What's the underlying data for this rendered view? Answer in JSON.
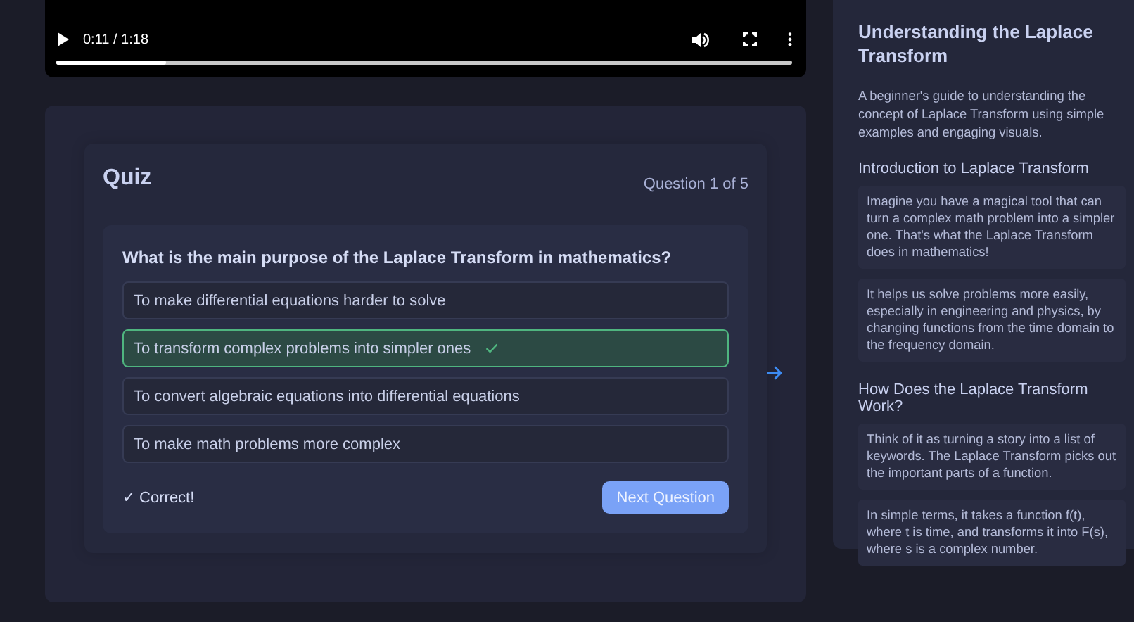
{
  "video": {
    "playing": false,
    "time": "0:11 / 1:18",
    "level": 0.15
  },
  "quiz": {
    "title": "Quiz",
    "progress": "Question 1 of 5",
    "question": "What is the main purpose of the Laplace Transform in mathematics?",
    "options": [
      {
        "label": "To make differential equations harder to solve",
        "selected": false
      },
      {
        "label": "To transform complex problems into simpler ones",
        "selected": true
      },
      {
        "label": "To convert algebraic equations into differential equations",
        "selected": false
      },
      {
        "label": "To make math problems more complex",
        "selected": false
      }
    ],
    "feedback": "✓ Correct!",
    "next_button": "Next Question"
  },
  "sidebar": {
    "title": "Understanding the Laplace Transform",
    "description": "A beginner's guide to understanding the concept of Laplace Transform using simple examples and engaging visuals.",
    "sections": [
      {
        "heading": "Introduction to Laplace Transform",
        "paragraphs": [
          "Imagine you have a magical tool that can turn a complex math problem into a simpler one. That's what the Laplace Transform does in mathematics!",
          "It helps us solve problems more easily, especially in engineering and physics, by changing functions from the time domain to the frequency domain."
        ]
      },
      {
        "heading": "How Does the Laplace Transform Work?",
        "paragraphs": [
          "Think of it as turning a story into a list of keywords. The Laplace Transform picks out the important parts of a function.",
          "In simple terms, it takes a function f(t), where t is time, and transforms it into F(s), where s is a complex number."
        ]
      }
    ]
  }
}
